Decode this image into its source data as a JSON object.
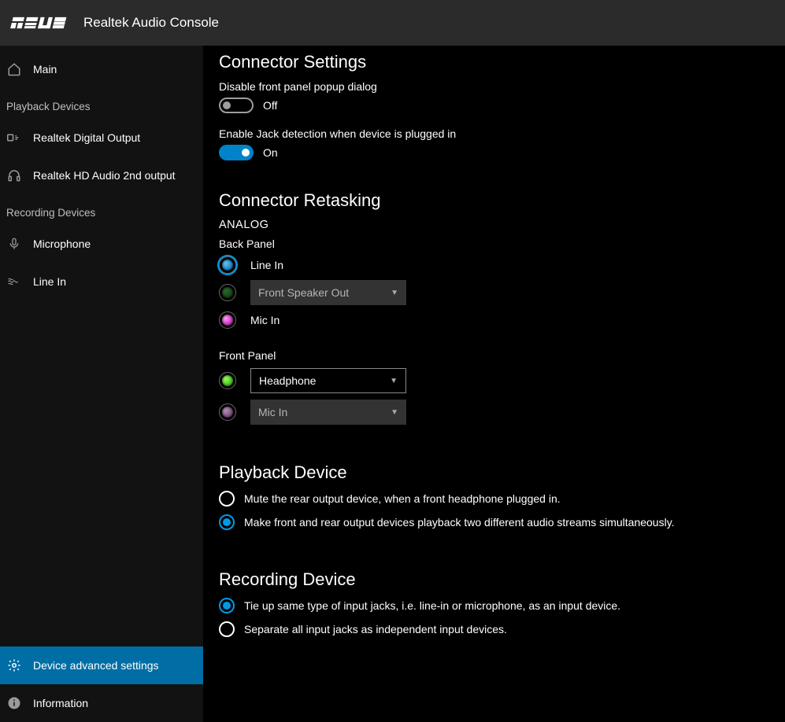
{
  "header": {
    "app_title": "Realtek Audio Console"
  },
  "sidebar": {
    "main": "Main",
    "playback_header": "Playback Devices",
    "recording_header": "Recording Devices",
    "playback_items": [
      {
        "label": "Realtek Digital Output"
      },
      {
        "label": "Realtek HD Audio 2nd output"
      }
    ],
    "recording_items": [
      {
        "label": "Microphone"
      },
      {
        "label": "Line In"
      }
    ],
    "device_advanced": "Device advanced settings",
    "information": "Information"
  },
  "content": {
    "connector_settings": {
      "title": "Connector Settings",
      "disable_popup_label": "Disable front panel popup dialog",
      "disable_popup_state": "Off",
      "enable_jack_label": "Enable Jack detection when device is plugged in",
      "enable_jack_state": "On"
    },
    "retasking": {
      "title": "Connector Retasking",
      "analog": "ANALOG",
      "back_panel": "Back Panel",
      "front_panel": "Front Panel",
      "back_items": [
        {
          "label": "Line In"
        },
        {
          "label": "Front Speaker Out"
        },
        {
          "label": "Mic In"
        }
      ],
      "front_items": [
        {
          "label": "Headphone"
        },
        {
          "label": "Mic In"
        }
      ]
    },
    "playback_device": {
      "title": "Playback Device",
      "opt1": "Mute the rear output device, when a front headphone plugged in.",
      "opt2": "Make front and rear output devices playback two different audio streams simultaneously."
    },
    "recording_device": {
      "title": "Recording Device",
      "opt1": "Tie up same type of input jacks, i.e. line-in or microphone, as an input device.",
      "opt2": "Separate all input jacks as independent input devices."
    }
  }
}
